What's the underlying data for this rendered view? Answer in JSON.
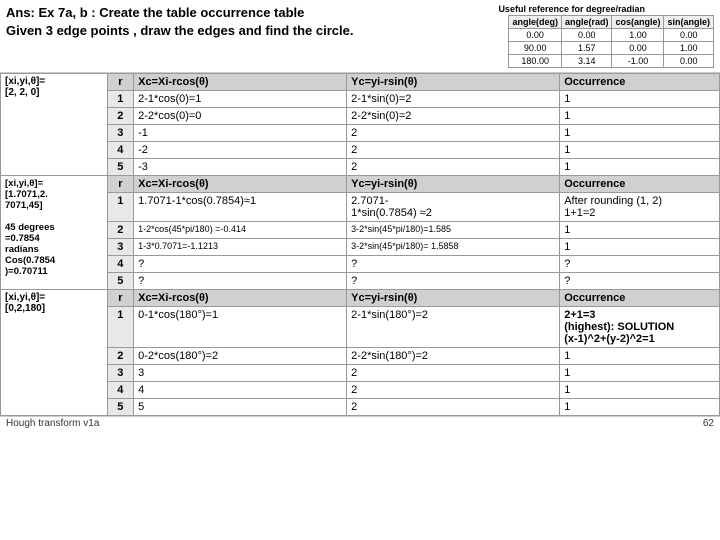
{
  "header": {
    "title_line1": "Ans: Ex 7a, b : Create the table occurrence table",
    "title_line2": "Given 3 edge points , draw the edges and find the circle."
  },
  "ref_table": {
    "title": "Useful reference for degree/radian",
    "headers": [
      "angle(deg)",
      "angle(rad)",
      "cos(angle)",
      "sin(angle)"
    ],
    "rows": [
      [
        "0.00",
        "0.00",
        "1.00",
        "0.00"
      ],
      [
        "90.00",
        "1.57",
        "0.00",
        "1.00"
      ],
      [
        "180.00",
        "3.14",
        "-1.00",
        "0.00"
      ]
    ]
  },
  "table": {
    "col_headers": [
      "",
      "r",
      "Xc=Xi-rcos(θ)",
      "Yc=yi-rsin(θ)",
      "Occurrence"
    ],
    "section1": {
      "label": "[xi,yi,θ]=\n[2, 2, 0]",
      "rows": [
        {
          "r": "r",
          "xc": "Xc=Xi-rcos(θ)",
          "yc": "Yc=yi-rsin(θ)",
          "occ": "Occurrence",
          "is_header": true
        },
        {
          "r": "1",
          "xc": "2-1*cos(0)=1",
          "yc": "2-1*sin(0)=2",
          "occ": "1"
        },
        {
          "r": "2",
          "xc": "2-2*cos(0)=0",
          "yc": "2-2*sin(0)=2",
          "occ": "1"
        },
        {
          "r": "3",
          "xc": "-1",
          "yc": "2",
          "occ": "1"
        },
        {
          "r": "4",
          "xc": "-2",
          "yc": "2",
          "occ": "1"
        },
        {
          "r": "5",
          "xc": "-3",
          "yc": "2",
          "occ": "1"
        }
      ]
    },
    "section2": {
      "label": "[xi,yi,θ]=\n[1.7071,2.\n7071,45]\n\n45 degrees\n=0.7854\nradians\nCos(0.7854\n)=0.70711",
      "rows": [
        {
          "r": "r",
          "xc": "Xc=Xi-rcos(θ)",
          "yc": "Yc=yi-rsin(θ)",
          "occ": "Occurrence",
          "is_header": true
        },
        {
          "r": "1",
          "xc": "1.7071-1*cos(0.7854)≈1",
          "yc": "2.7071-\n1*sin(0.7854) ≈2",
          "occ": "After rounding (1, 2)\n1+1=2"
        },
        {
          "r": "2",
          "xc": "1-2*cos(45*pi/180) =-0.414",
          "yc": "3-2*sin(45*pi/180)=1.585",
          "occ": "1"
        },
        {
          "r": "3",
          "xc": "1-3*0.7071=-1.1213",
          "yc": "3-2*sin(45*pi/180)= 1.5858",
          "occ": "1"
        },
        {
          "r": "4",
          "xc": "?",
          "yc": "?",
          "occ": "?"
        },
        {
          "r": "5",
          "xc": "?",
          "yc": "?",
          "occ": "?"
        }
      ]
    },
    "section3": {
      "label": "[xi,yi,θ]=\n[0,2,180]",
      "rows": [
        {
          "r": "r",
          "xc": "Xc=Xi-rcos(θ)",
          "yc": "Yc=yi-rsin(θ)",
          "occ": "Occurrence",
          "is_header": true
        },
        {
          "r": "1",
          "xc": "0-1*cos(180°)=1",
          "yc": "2-1*sin(180°)=2",
          "occ": "2+1=3\n(highest): SOLUTION\n(x-1)^2+(y-2)^2=1"
        },
        {
          "r": "2",
          "xc": "0-2*cos(180°)=2",
          "yc": "2-2*sin(180°)=2",
          "occ": "1"
        },
        {
          "r": "3",
          "xc": "3",
          "yc": "2",
          "occ": "1"
        },
        {
          "r": "4",
          "xc": "4",
          "yc": "2",
          "occ": "1"
        },
        {
          "r": "5",
          "xc": "5",
          "yc": "2",
          "occ": "1"
        }
      ]
    }
  },
  "footer": {
    "label": "Hough transform v1a",
    "page": "62"
  }
}
